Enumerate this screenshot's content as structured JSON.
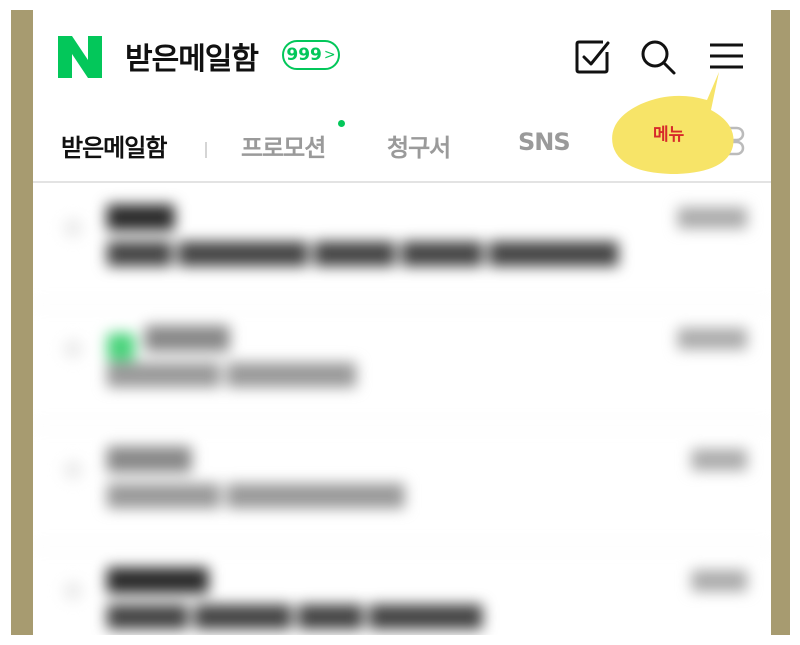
{
  "header": {
    "logo_letter": "N",
    "title": "받은메일함",
    "unread_count": "999",
    "unread_chevron": ">"
  },
  "icons": {
    "compose": "checkbox-icon",
    "search": "search-icon",
    "menu": "menu-icon",
    "more": "toggle-icon"
  },
  "tabs": [
    {
      "label": "받은메일함",
      "active": true
    },
    {
      "label": "프로모션",
      "active": false,
      "has_new": true
    },
    {
      "label": "청구서",
      "active": false
    },
    {
      "label": "SNS",
      "active": false
    }
  ],
  "callout": {
    "text": "메뉴"
  },
  "mail_list": [
    {
      "sender": "████",
      "subject": "████ ████████ █████ █████ ████████",
      "date": "█████"
    },
    {
      "sender": "█████",
      "subject": "███████ ████████",
      "date": "█████"
    },
    {
      "sender": "█████",
      "subject": "███████ ███████████",
      "date": "████"
    },
    {
      "sender": "██████",
      "subject": "█████ ██████ ████ ███████",
      "date": "████"
    }
  ],
  "colors": {
    "brand": "#03c75a",
    "frame": "#a79b70",
    "callout": "#f7e468",
    "callout_text": "#d7292a"
  }
}
